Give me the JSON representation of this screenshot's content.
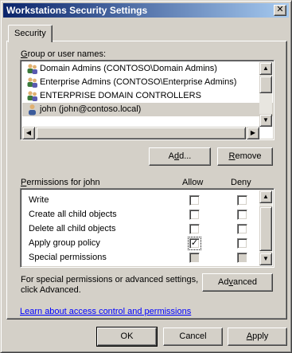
{
  "window": {
    "title": "Workstations Security Settings",
    "close_glyph": "✕"
  },
  "tabs": [
    {
      "label": "Security",
      "selected": true
    }
  ],
  "groups": {
    "label": "Group or user names:",
    "items": [
      {
        "name": "Domain Admins (CONTOSO\\Domain Admins)",
        "icon": "group-icon",
        "selected": false
      },
      {
        "name": "Enterprise Admins (CONTOSO\\Enterprise Admins)",
        "icon": "group-icon",
        "selected": false
      },
      {
        "name": "ENTERPRISE DOMAIN CONTROLLERS",
        "icon": "group-icon",
        "selected": false
      },
      {
        "name": "john (john@contoso.local)",
        "icon": "user-icon",
        "selected": true
      }
    ]
  },
  "buttons": {
    "add": "Add...",
    "remove": "Remove",
    "advanced": "Advanced",
    "ok": "OK",
    "cancel": "Cancel",
    "apply": "Apply"
  },
  "permissions": {
    "label": "Permissions for john",
    "allow_header": "Allow",
    "deny_header": "Deny",
    "rows": [
      {
        "name": "Write",
        "allow": false,
        "deny": false,
        "disabled": false
      },
      {
        "name": "Create all child objects",
        "allow": false,
        "deny": false,
        "disabled": false
      },
      {
        "name": "Delete all child objects",
        "allow": false,
        "deny": false,
        "disabled": false
      },
      {
        "name": "Apply group policy",
        "allow": true,
        "deny": false,
        "disabled": false
      },
      {
        "name": "Special permissions",
        "allow": false,
        "deny": false,
        "disabled": true
      }
    ]
  },
  "advanced_note": "For special permissions or advanced settings, click Advanced.",
  "learn_link": "Learn about access control and permissions",
  "colors": {
    "titlebar_start": "#0a246a",
    "titlebar_end": "#a6caf0",
    "face": "#d4d0c8",
    "link": "#0000ff"
  }
}
